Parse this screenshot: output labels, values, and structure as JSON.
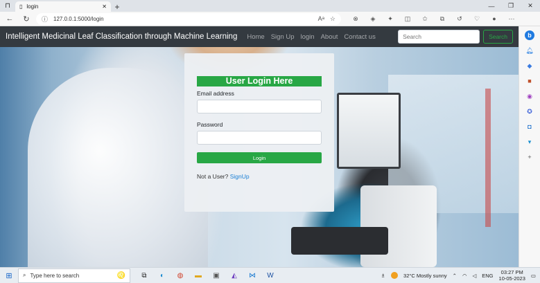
{
  "browser": {
    "tab_title": "login",
    "url": "127.0.0.1:5000/login",
    "colors": {
      "accent": "#28a745",
      "navbar": "#343a40",
      "link": "#1a7fd4"
    }
  },
  "navbar": {
    "brand": "Intelligent Medicinal Leaf Classification through Machine Learning",
    "links": [
      "Home",
      "Sign Up",
      "login",
      "About",
      "Contact us"
    ],
    "search_placeholder": "Search",
    "search_button": "Search"
  },
  "login": {
    "heading": "User Login Here",
    "email_label": "Email address",
    "email_value": "",
    "password_label": "Password",
    "password_value": "",
    "submit_label": "Login",
    "signup_prompt": "Not a User?",
    "signup_link": "SignUp"
  },
  "taskbar": {
    "search_placeholder": "Type here to search",
    "weather": "32°C  Mostly sunny",
    "language": "ENG",
    "time": "03:27 PM",
    "date": "10-05-2023"
  }
}
